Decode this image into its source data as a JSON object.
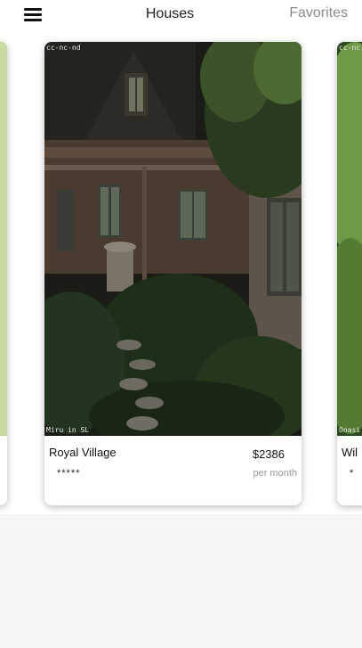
{
  "header": {
    "title": "Houses",
    "favorites_label": "Favorites",
    "menu_icon": "hamburger-menu-icon"
  },
  "cards": [
    {
      "name": "",
      "license_top": "",
      "license_bottom": ""
    },
    {
      "name": "Royal Village",
      "rating": "*****",
      "price": "$2386",
      "price_unit": "per month",
      "license_top": "cc-nc-nd",
      "license_bottom": "Miru in SL"
    },
    {
      "name": "Wil",
      "rating": "*",
      "license_top": "cc-nc-nd",
      "license_bottom": "Onasi"
    }
  ]
}
